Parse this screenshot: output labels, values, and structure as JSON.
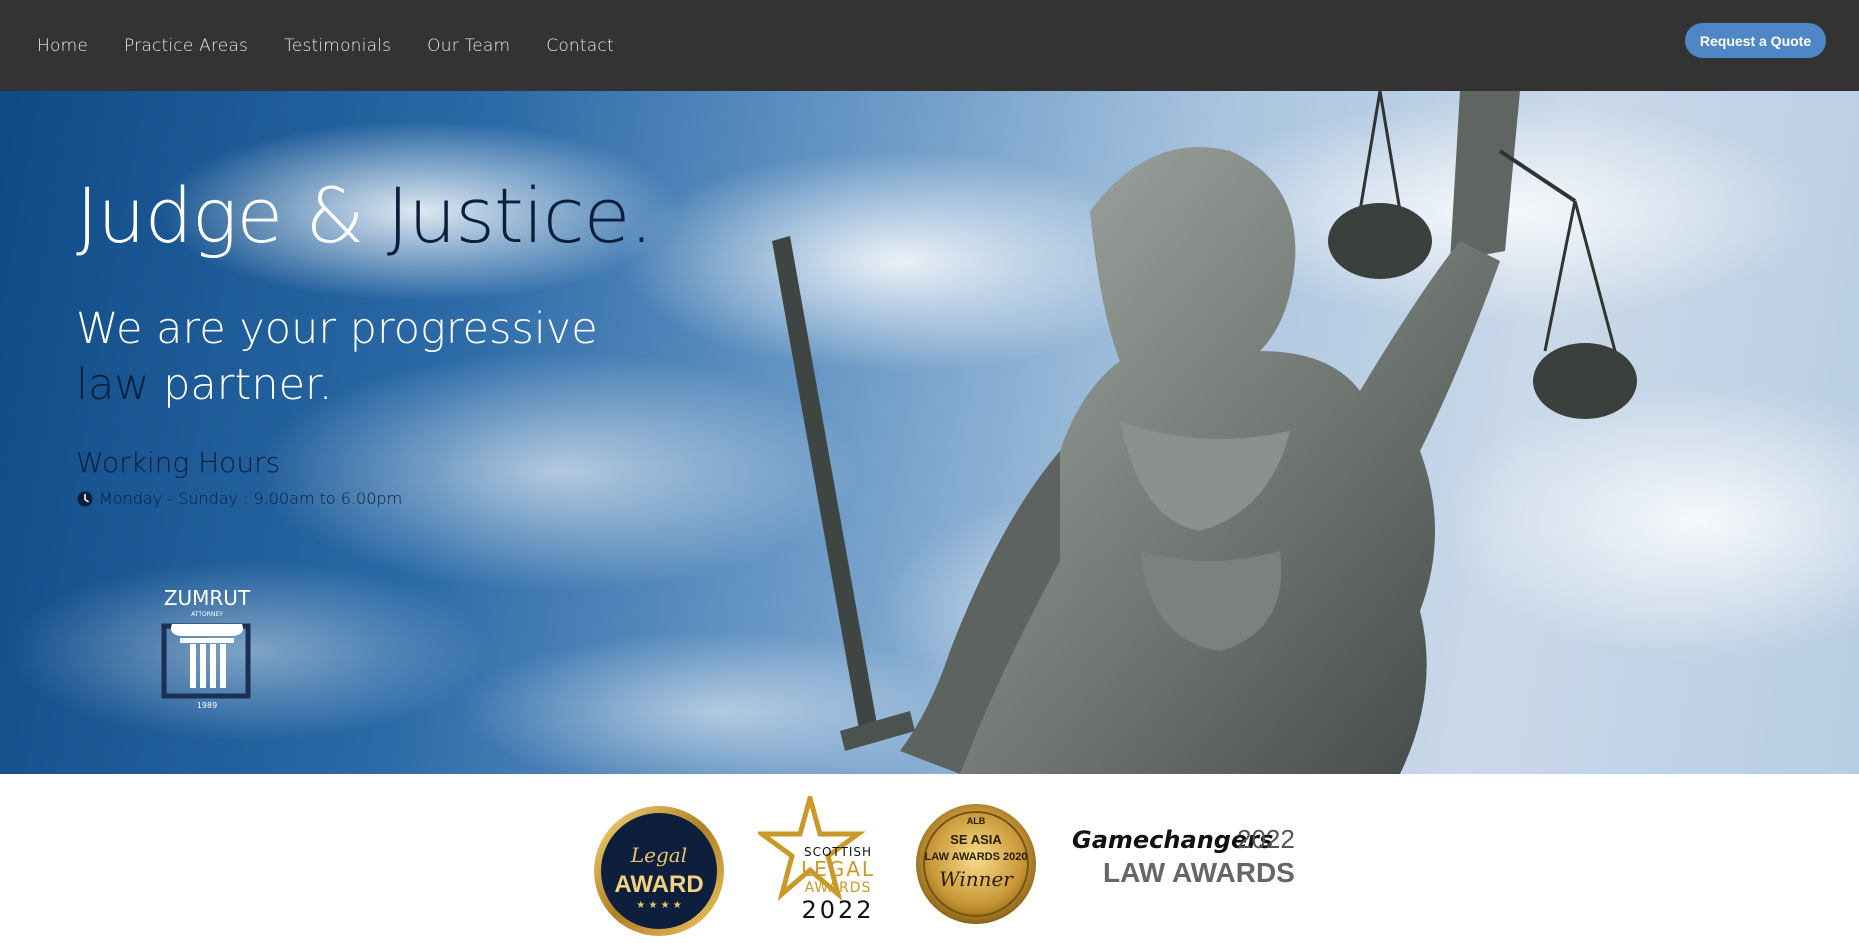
{
  "nav": {
    "links": [
      "Home",
      "Practice Areas",
      "Testimonials",
      "Our Team",
      "Contact"
    ],
    "cta_label": "Request a Quote"
  },
  "hero": {
    "title_part1": "Judge & ",
    "title_part2": "Justice.",
    "subtitle_line1": "We are your progressive",
    "subtitle_dark": "law",
    "subtitle_end": " partner.",
    "hours_title": "Working Hours",
    "hours_text": "Monday - Sunday : 9.00am to 6.00pm",
    "logo": {
      "name": "ZUMRUT",
      "tagline": "ATTORNEY",
      "year": "1989"
    }
  },
  "awards": [
    {
      "line1": "Legal",
      "line2": "AWARD"
    },
    {
      "line1": "SCOTTISH",
      "line2": "LEGAL",
      "line3": "AWARDS",
      "line4": "2022"
    },
    {
      "line1": "ALB",
      "line2": "SE ASIA",
      "line3": "LAW AWARDS 2020",
      "line4": "Winner"
    },
    {
      "line1": "Gamechangers",
      "line2": "2022",
      "line3": "LAW AWARDS"
    }
  ],
  "colors": {
    "nav_bg": "#333333",
    "accent": "#4f86c6",
    "dark_text": "#0b1f3a"
  }
}
